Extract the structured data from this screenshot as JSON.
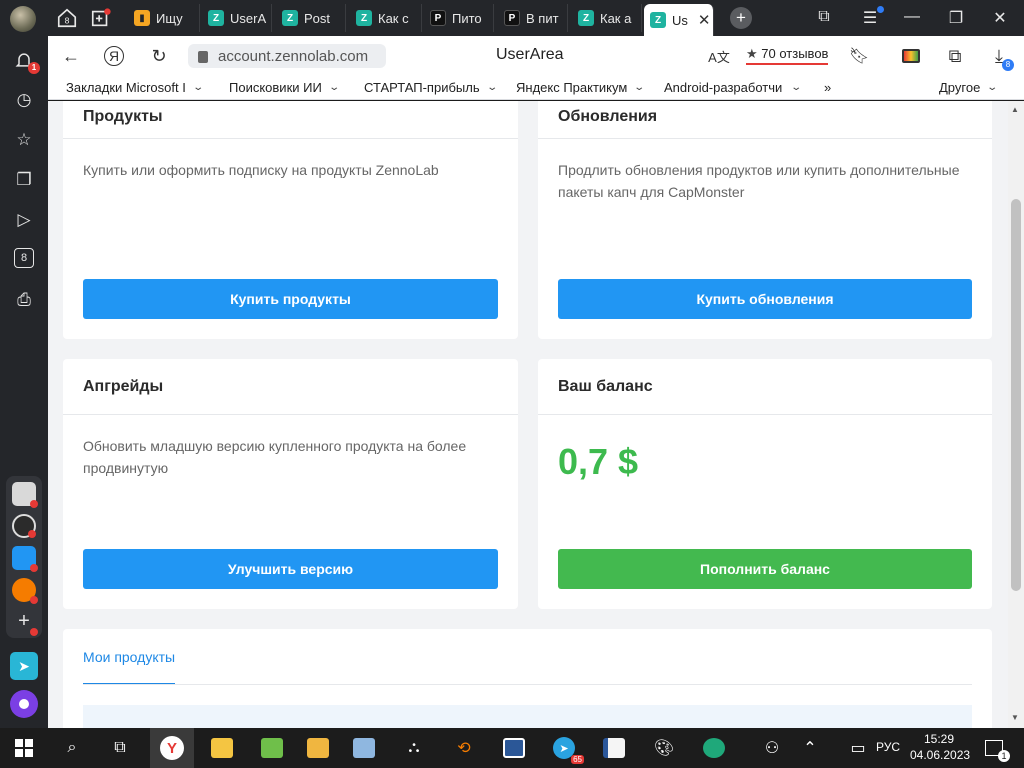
{
  "browser": {
    "tabs": [
      {
        "label": "Ищу",
        "favicon": "book-icon"
      },
      {
        "label": "UserA",
        "favicon": "zennolab-icon"
      },
      {
        "label": "Post",
        "favicon": "zennolab-icon"
      },
      {
        "label": "Как с",
        "favicon": "zennolab-icon"
      },
      {
        "label": "Пито",
        "favicon": "p-icon"
      },
      {
        "label": "В пит",
        "favicon": "p-icon"
      },
      {
        "label": "Как а",
        "favicon": "zennolab-icon"
      },
      {
        "label": "Us",
        "favicon": "zennolab-icon",
        "active": true
      }
    ],
    "home_badge": "8",
    "url": "account.zennolab.com",
    "page_title": "UserArea",
    "reviews_label": "70 отзывов",
    "downloads_badge": "8",
    "notifications_badge": "1"
  },
  "bookmarks": [
    "Закладки Microsoft Ir",
    "Поисковики ИИ",
    "СТАРТАП-прибыль",
    "Яндекс Практикум",
    "Android-разработчи",
    "»",
    "Другое"
  ],
  "cards": {
    "products": {
      "title": "Продукты",
      "description": "Купить или оформить подписку на продукты ZennoLab",
      "button": "Купить продукты"
    },
    "updates": {
      "title": "Обновления",
      "description": "Продлить обновления продуктов или купить дополнительные пакеты капч для CapMonster",
      "button": "Купить обновления"
    },
    "upgrades": {
      "title": "Апгрейды",
      "description": "Обновить младшую версию купленного продукта на более продвинутую",
      "button": "Улучшить версию"
    },
    "balance": {
      "title": "Ваш баланс",
      "amount": "0,7 $",
      "button": "Пополнить баланс"
    }
  },
  "my_products_tab": "Мои продукты",
  "taskbar": {
    "telegram_badge": "65",
    "language": "РУС",
    "time": "15:29",
    "date": "04.06.2023",
    "notification_count": "1"
  },
  "colors": {
    "primary_button": "#2196f3",
    "success_button": "#43b94f",
    "balance_text": "#3dba4e",
    "active_tab_underline": "#1e88e5"
  }
}
